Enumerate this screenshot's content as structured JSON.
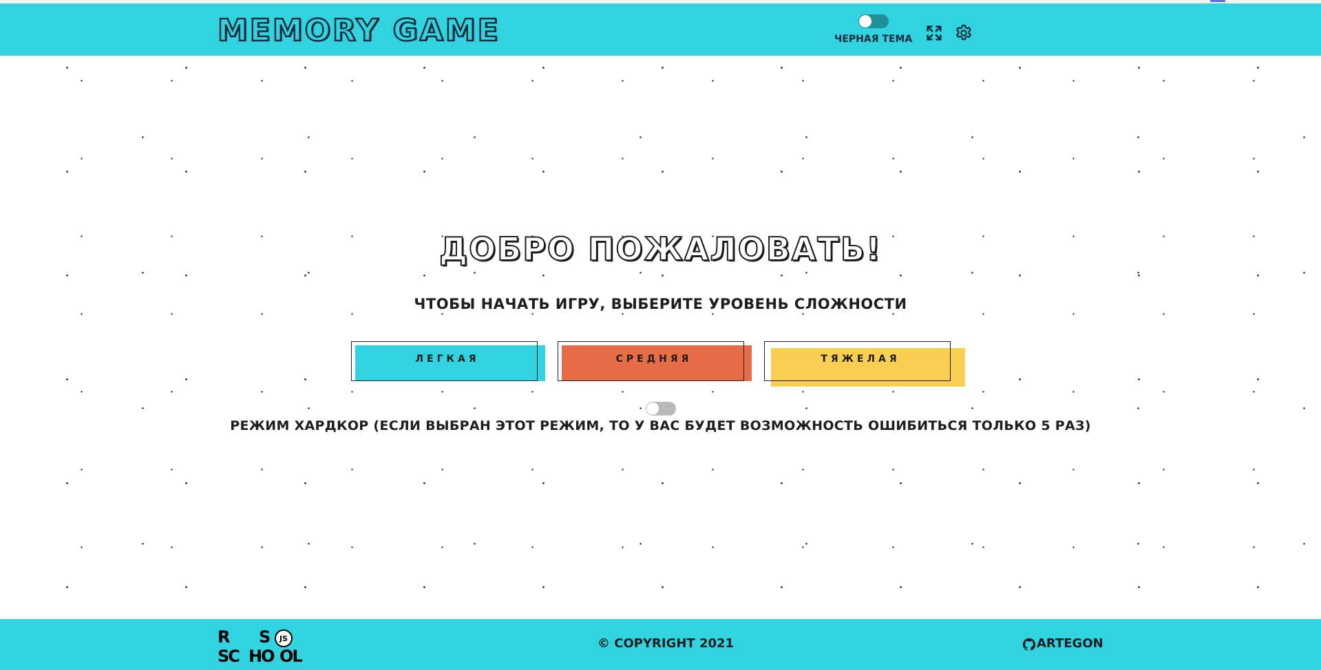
{
  "header": {
    "title": "MEMORY GAME",
    "theme_label": "ЧЕРНАЯ ТЕМА",
    "theme_toggle_on": false,
    "fullscreen_icon": "fullscreen-icon",
    "settings_icon": "gear-icon"
  },
  "main": {
    "welcome": "ДОБРО ПОЖАЛОВАТЬ!",
    "subtitle": "ЧТОБЫ НАЧАТЬ ИГРУ, ВЫБЕРИТЕ УРОВЕНЬ СЛОЖНОСТИ",
    "levels": [
      {
        "label": "ЛЕГКАЯ",
        "color": "#31d3e0"
      },
      {
        "label": "СРЕДНЯЯ",
        "color": "#e66d47"
      },
      {
        "label": "ТЯЖЕЛАЯ",
        "color": "#f8cf51"
      }
    ],
    "hardcore_toggle_on": false,
    "hardcore_label": "РЕЖИМ ХАРДКОР (ЕСЛИ ВЫБРАН ЭТОТ РЕЖИМ, ТО У ВАС БУДЕТ ВОЗМОЖНОСТЬ ОШИБИТЬСЯ ТОЛЬКО 5 РАЗ)"
  },
  "footer": {
    "school_logo": {
      "row1": [
        "R",
        "S",
        "JS"
      ],
      "row2": [
        "SC",
        "HO",
        "OL"
      ]
    },
    "copyright": "© COPYRIGHT 2021",
    "author": "ARTEGON",
    "author_icon": "github-icon"
  },
  "colors": {
    "accent": "#31d3e0",
    "text": "#1d1d1d",
    "medium": "#e66d47",
    "hard": "#f8cf51"
  }
}
